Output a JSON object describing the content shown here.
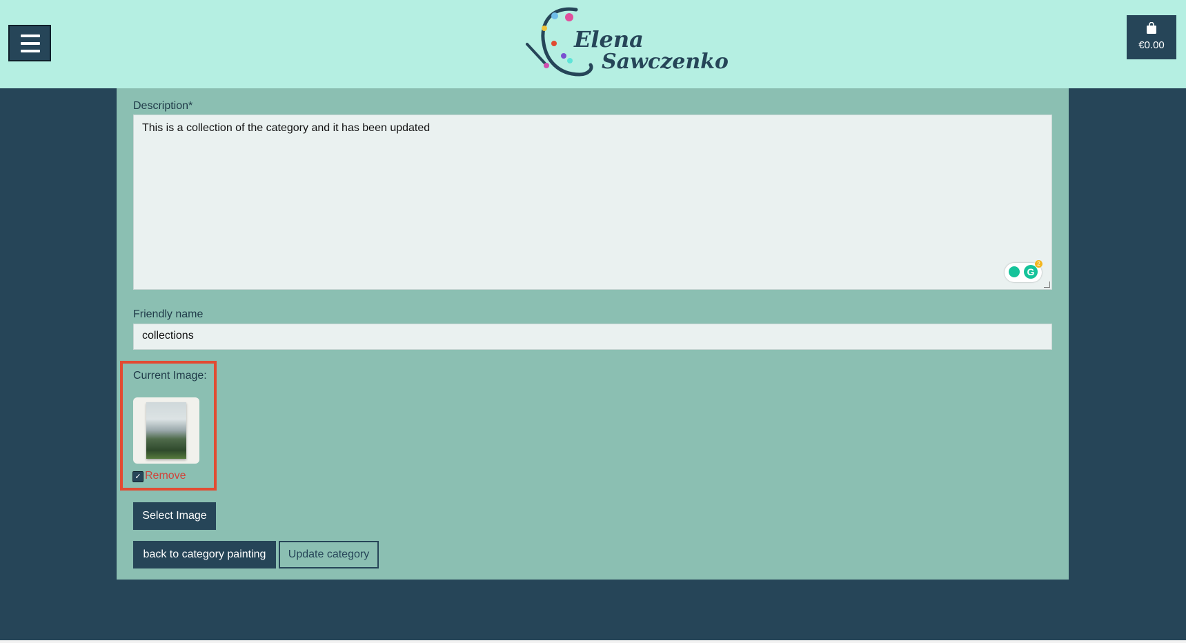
{
  "header": {
    "logo_line1": "Elena",
    "logo_line2": "Sawczenko",
    "cart_total": "€0.00"
  },
  "form": {
    "description_label": "Description*",
    "description_value": "This is a collection of the category and it has been updated",
    "friendly_name_label": "Friendly name",
    "friendly_name_value": "collections",
    "current_image_label": "Current Image:",
    "remove_label": "Remove",
    "remove_checked": true,
    "select_image_label": "Select Image",
    "back_label": "back to category painting",
    "update_label": "Update category",
    "grammarly_badge": "2",
    "grammarly_letter": "G"
  },
  "colors": {
    "header_bg": "#b5efe2",
    "page_bg": "#264558",
    "panel_bg": "#8bbfb2",
    "highlight": "#e24b32",
    "remove_text": "#d0433a"
  },
  "icons": {
    "menu": "hamburger-icon",
    "cart": "shopping-bag-icon",
    "logo": "paint-palette-icon"
  }
}
